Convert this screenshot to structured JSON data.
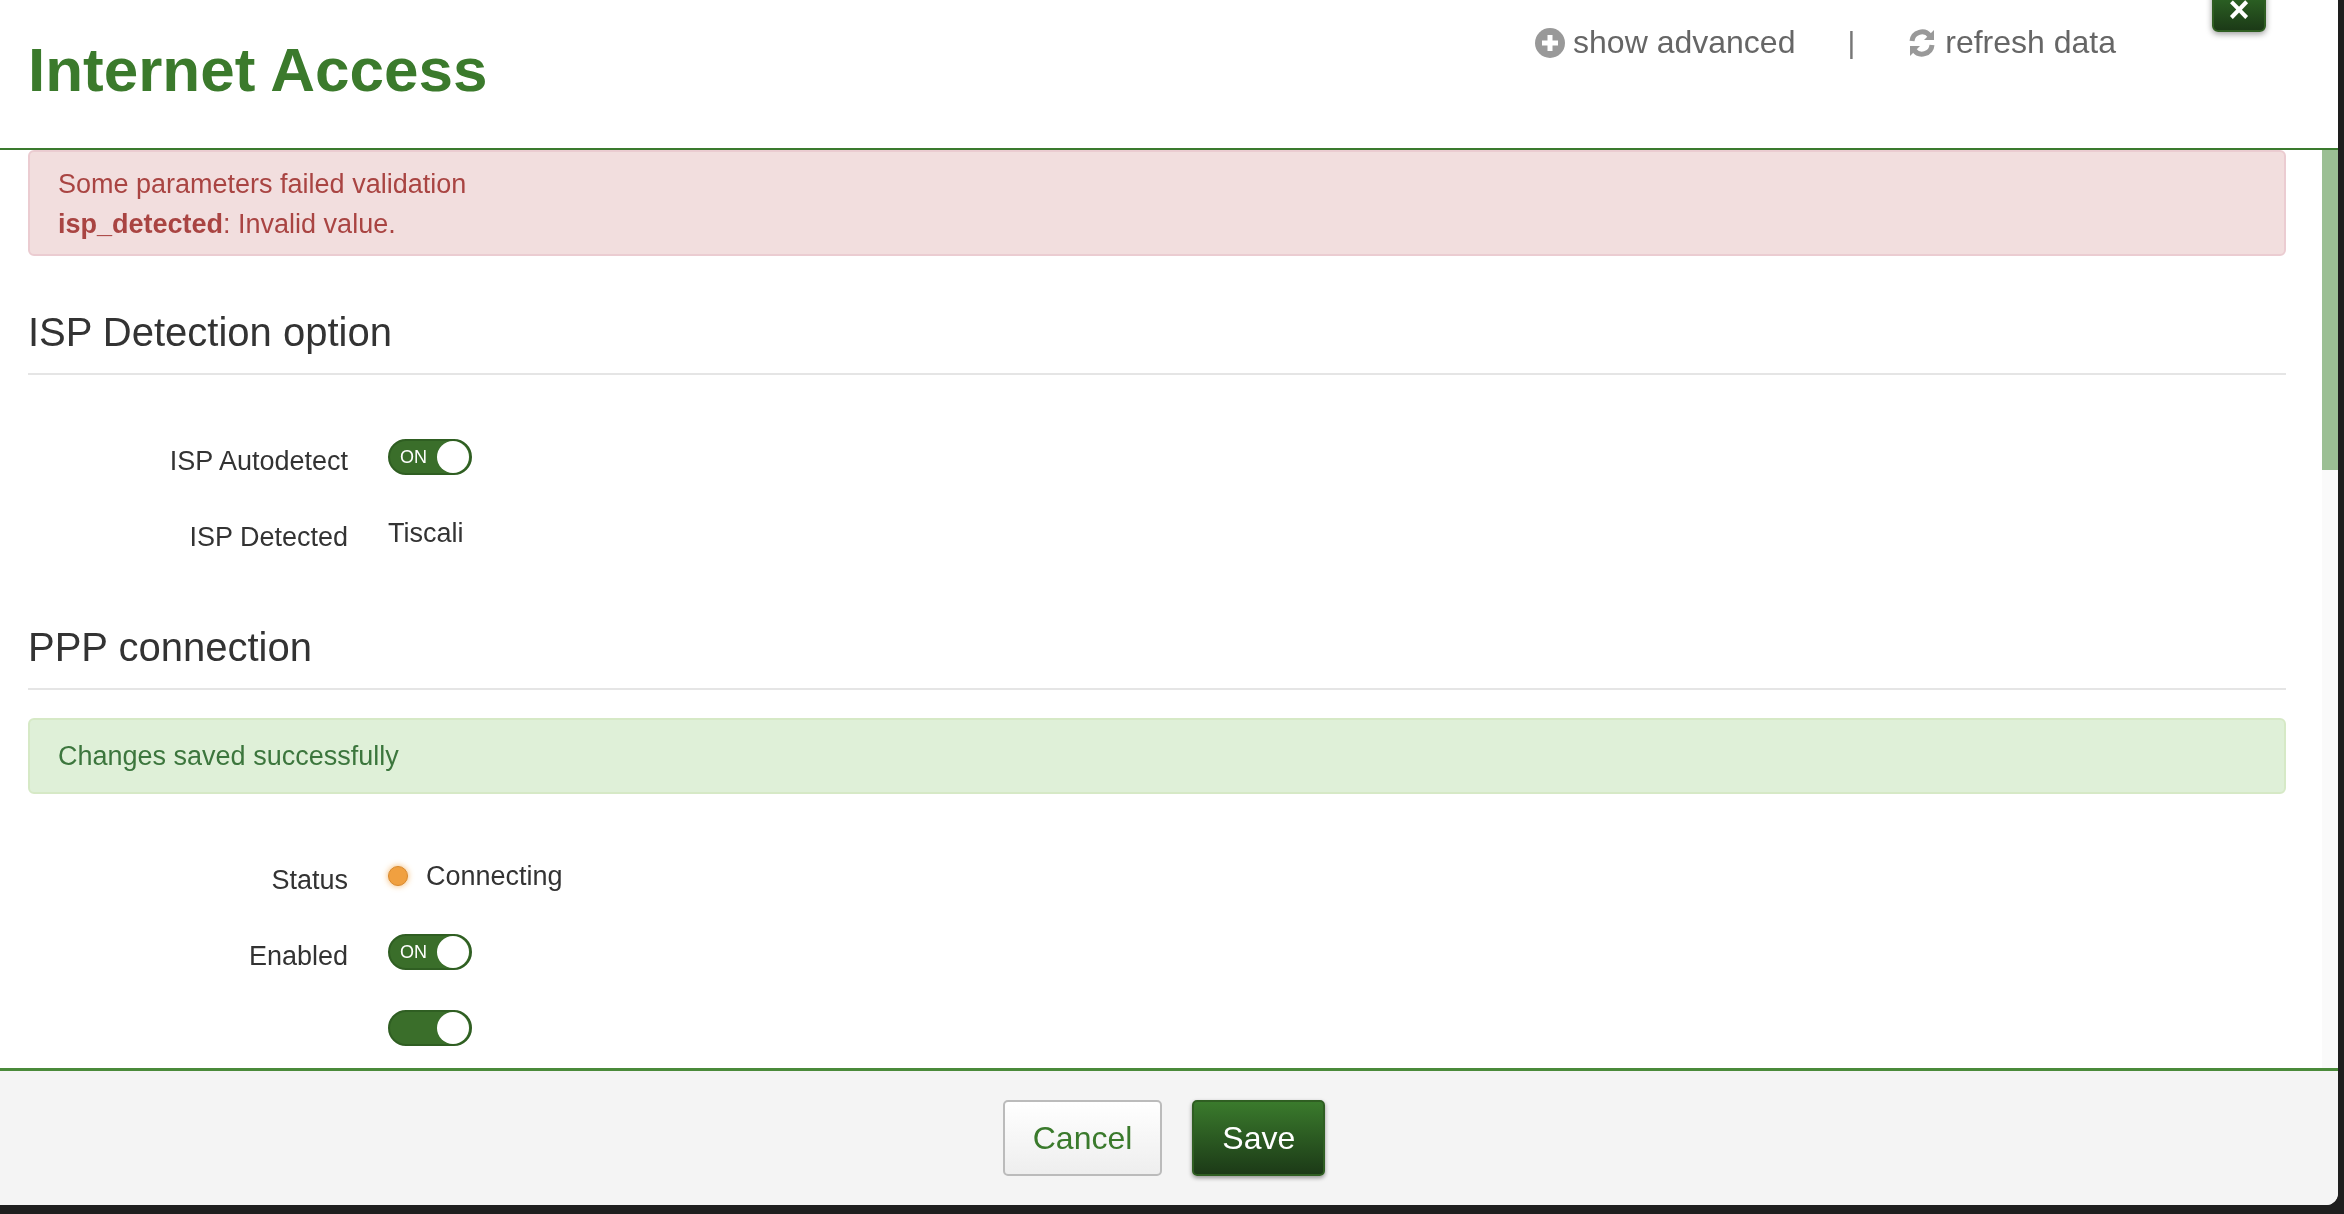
{
  "dialog": {
    "title": "Internet Access",
    "header_links": [
      {
        "kind": "plus",
        "label": "show advanced"
      },
      {
        "kind": "refresh",
        "label": "refresh data"
      }
    ],
    "separator": "|",
    "close_label": "×"
  },
  "error_alert": {
    "lines": [
      "Some parameters failed validation",
      "**isp_detected**: Invalid value."
    ]
  },
  "sections": [
    {
      "heading": "ISP Detection option",
      "fields": [
        {
          "kind": "toggle",
          "label": "ISP Autodetect",
          "on": true,
          "switch_label": "ON"
        },
        {
          "kind": "text",
          "label": "ISP Detected",
          "value": "Tiscali"
        }
      ]
    },
    {
      "heading": "PPP connection",
      "success_alert": "Changes saved successfully",
      "fields": [
        {
          "kind": "status",
          "label": "Status",
          "value": "Connecting",
          "color": "#f0a040"
        },
        {
          "kind": "toggle",
          "label": "Enabled",
          "on": true,
          "switch_label": "ON"
        },
        {
          "kind": "toggle",
          "on": true
        }
      ]
    }
  ],
  "footer": {
    "buttons": [
      {
        "kind": "secondary",
        "label": "Cancel"
      },
      {
        "kind": "primary",
        "label": "Save"
      }
    ]
  }
}
